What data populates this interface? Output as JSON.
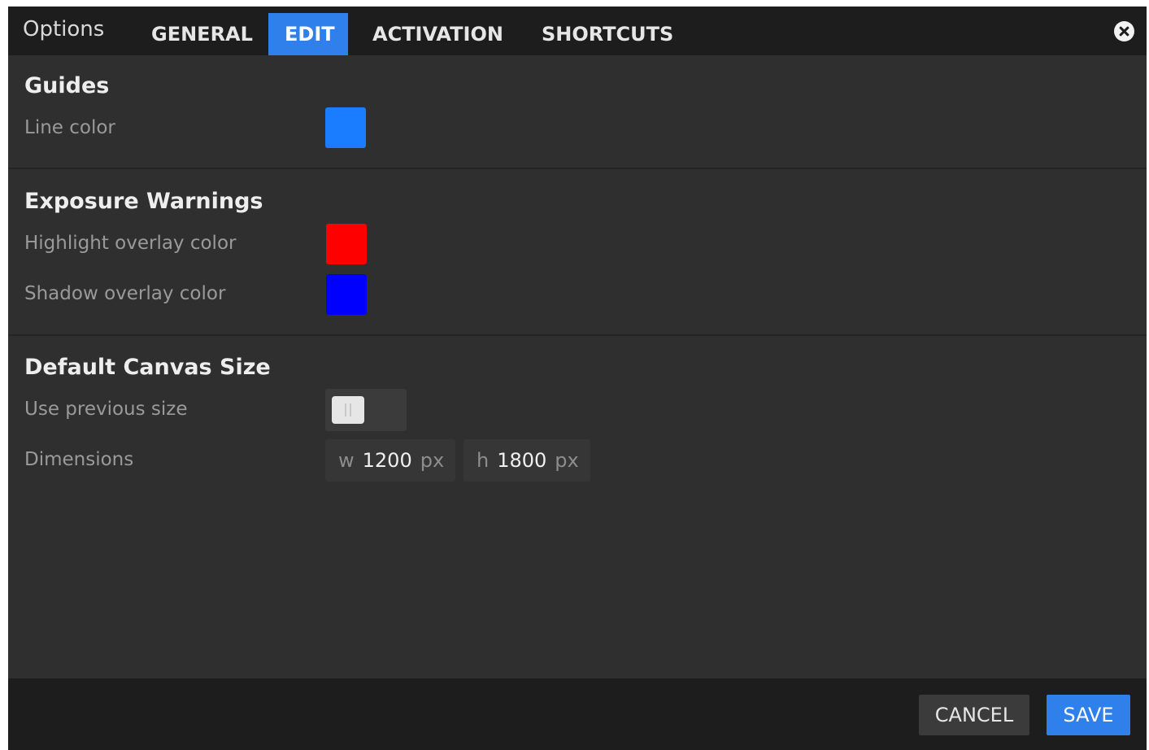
{
  "window": {
    "title": "Options",
    "tabs": [
      {
        "label": "GENERAL",
        "active": false
      },
      {
        "label": "EDIT",
        "active": true
      },
      {
        "label": "ACTIVATION",
        "active": false
      },
      {
        "label": "SHORTCUTS",
        "active": false
      }
    ],
    "close_icon": "close-circle-icon"
  },
  "guides": {
    "title": "Guides",
    "line_color_label": "Line color",
    "line_color": "#1a7cff"
  },
  "exposure": {
    "title": "Exposure Warnings",
    "highlight_label": "Highlight overlay color",
    "highlight_color": "#ff0000",
    "shadow_label": "Shadow overlay color",
    "shadow_color": "#0000ff"
  },
  "canvas": {
    "title": "Default Canvas Size",
    "use_previous_label": "Use previous size",
    "use_previous_on": false,
    "dimensions_label": "Dimensions",
    "width_prefix": "w",
    "width_value": "1200",
    "height_prefix": "h",
    "height_value": "1800",
    "unit": "px"
  },
  "footer": {
    "cancel_label": "CANCEL",
    "save_label": "SAVE"
  },
  "colors": {
    "accent": "#2f80ea",
    "panel": "#2f2f2f",
    "bar": "#1d1d1d"
  }
}
